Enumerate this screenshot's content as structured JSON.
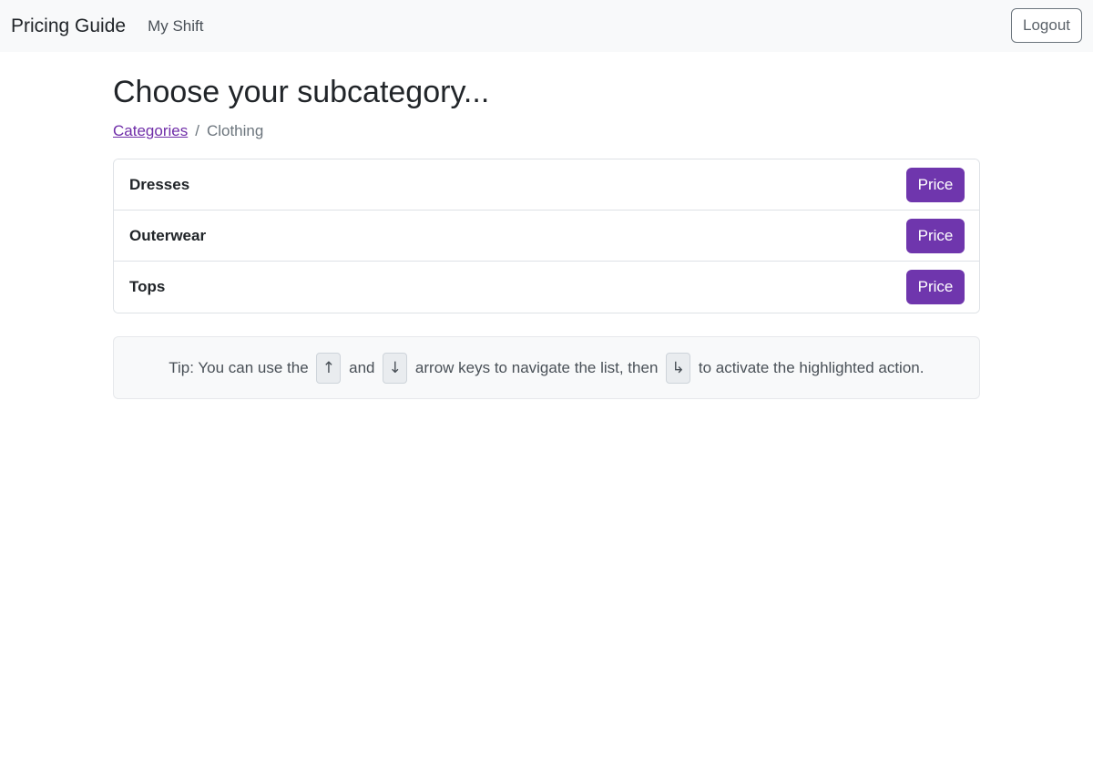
{
  "navbar": {
    "brand": "Pricing Guide",
    "my_shift": "My Shift",
    "logout": "Logout"
  },
  "page": {
    "title": "Choose your subcategory...",
    "breadcrumb": {
      "parent": "Categories",
      "separator": "/",
      "current": "Clothing"
    }
  },
  "subcategories": [
    {
      "name": "Dresses",
      "action": "Price"
    },
    {
      "name": "Outerwear",
      "action": "Price"
    },
    {
      "name": "Tops",
      "action": "Price"
    }
  ],
  "tip": {
    "part1": "Tip: You can use the",
    "up_key": "↑",
    "part2": "and",
    "down_key": "↓",
    "part3": "arrow keys to navigate the list, then",
    "enter_key": "↳",
    "part4": "to activate the highlighted action."
  },
  "colors": {
    "accent": "#6f36ad",
    "link": "#6f2da8",
    "navbar_bg": "#f8f9fa"
  }
}
